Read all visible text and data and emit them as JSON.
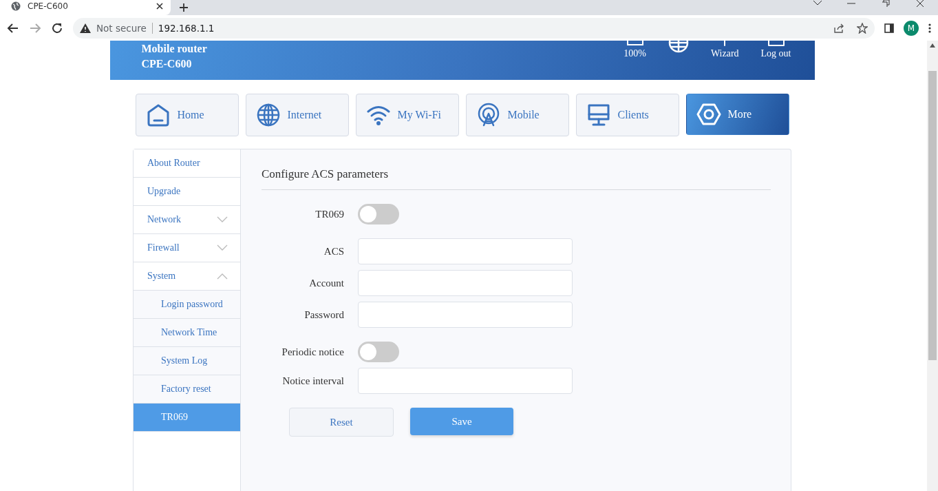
{
  "browser": {
    "tab_title": "CPE-C600",
    "security": "Not secure",
    "url": "192.168.1.1",
    "profile_initial": "M"
  },
  "header": {
    "title": "Mobile router",
    "model": "CPE-C600",
    "battery": "100%",
    "actions": [
      {
        "kind": "wizard",
        "label": "Wizard"
      },
      {
        "kind": "logout",
        "label": "Log out"
      }
    ]
  },
  "nav": [
    {
      "kind": "home",
      "label": "Home",
      "selected": false
    },
    {
      "kind": "internet",
      "label": "Internet",
      "selected": false
    },
    {
      "kind": "wifi",
      "label": "My Wi-Fi",
      "selected": false
    },
    {
      "kind": "mobile",
      "label": "Mobile",
      "selected": false
    },
    {
      "kind": "clients",
      "label": "Clients",
      "selected": false
    },
    {
      "kind": "more",
      "label": "More",
      "selected": true
    }
  ],
  "sidebar": {
    "items": [
      {
        "label": "About Router",
        "selected": false
      },
      {
        "label": "Upgrade",
        "selected": false
      },
      {
        "label": "Network",
        "selected": false,
        "expanded": false
      },
      {
        "label": "Firewall",
        "selected": false,
        "expanded": false
      },
      {
        "label": "System",
        "selected": false,
        "expanded": true,
        "children": [
          {
            "label": "Login password",
            "selected": false
          },
          {
            "label": "Network Time",
            "selected": false
          },
          {
            "label": "System Log",
            "selected": false
          },
          {
            "label": "Factory reset",
            "selected": false
          },
          {
            "label": "TR069",
            "selected": true
          }
        ]
      }
    ]
  },
  "form": {
    "title": "Configure ACS parameters",
    "fields": [
      {
        "kind": "switch",
        "label": "TR069",
        "on": false
      },
      {
        "kind": "text",
        "label": "ACS"
      },
      {
        "kind": "text",
        "label": "Account"
      },
      {
        "kind": "text",
        "label": "Password"
      },
      {
        "kind": "switch",
        "label": "Periodic notice",
        "on": false
      },
      {
        "kind": "text",
        "label": "Notice interval"
      }
    ],
    "buttons": [
      {
        "kind": "secondary",
        "label": "Reset"
      },
      {
        "kind": "primary",
        "label": "Save"
      }
    ]
  }
}
